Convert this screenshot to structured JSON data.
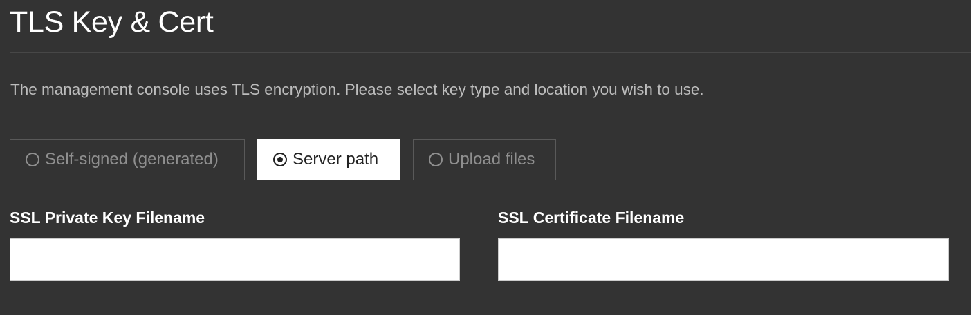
{
  "header": {
    "title": "TLS Key & Cert"
  },
  "description": "The management console uses TLS encryption. Please select key type and location you wish to use.",
  "key_type": {
    "selected": "Server path",
    "options": [
      {
        "label": "Self-signed (generated)",
        "selected": false
      },
      {
        "label": "Server path",
        "selected": true
      },
      {
        "label": "Upload files",
        "selected": false
      }
    ]
  },
  "fields": {
    "private_key": {
      "label": "SSL Private Key Filename",
      "value": "",
      "placeholder": ""
    },
    "certificate": {
      "label": "SSL Certificate Filename",
      "value": "",
      "placeholder": ""
    }
  },
  "colors": {
    "background": "#333333",
    "title_text": "#ffffff",
    "body_text": "#bdbdbd",
    "selected_option_bg": "#ffffff",
    "unselected_option_text": "#8f8f8f"
  }
}
